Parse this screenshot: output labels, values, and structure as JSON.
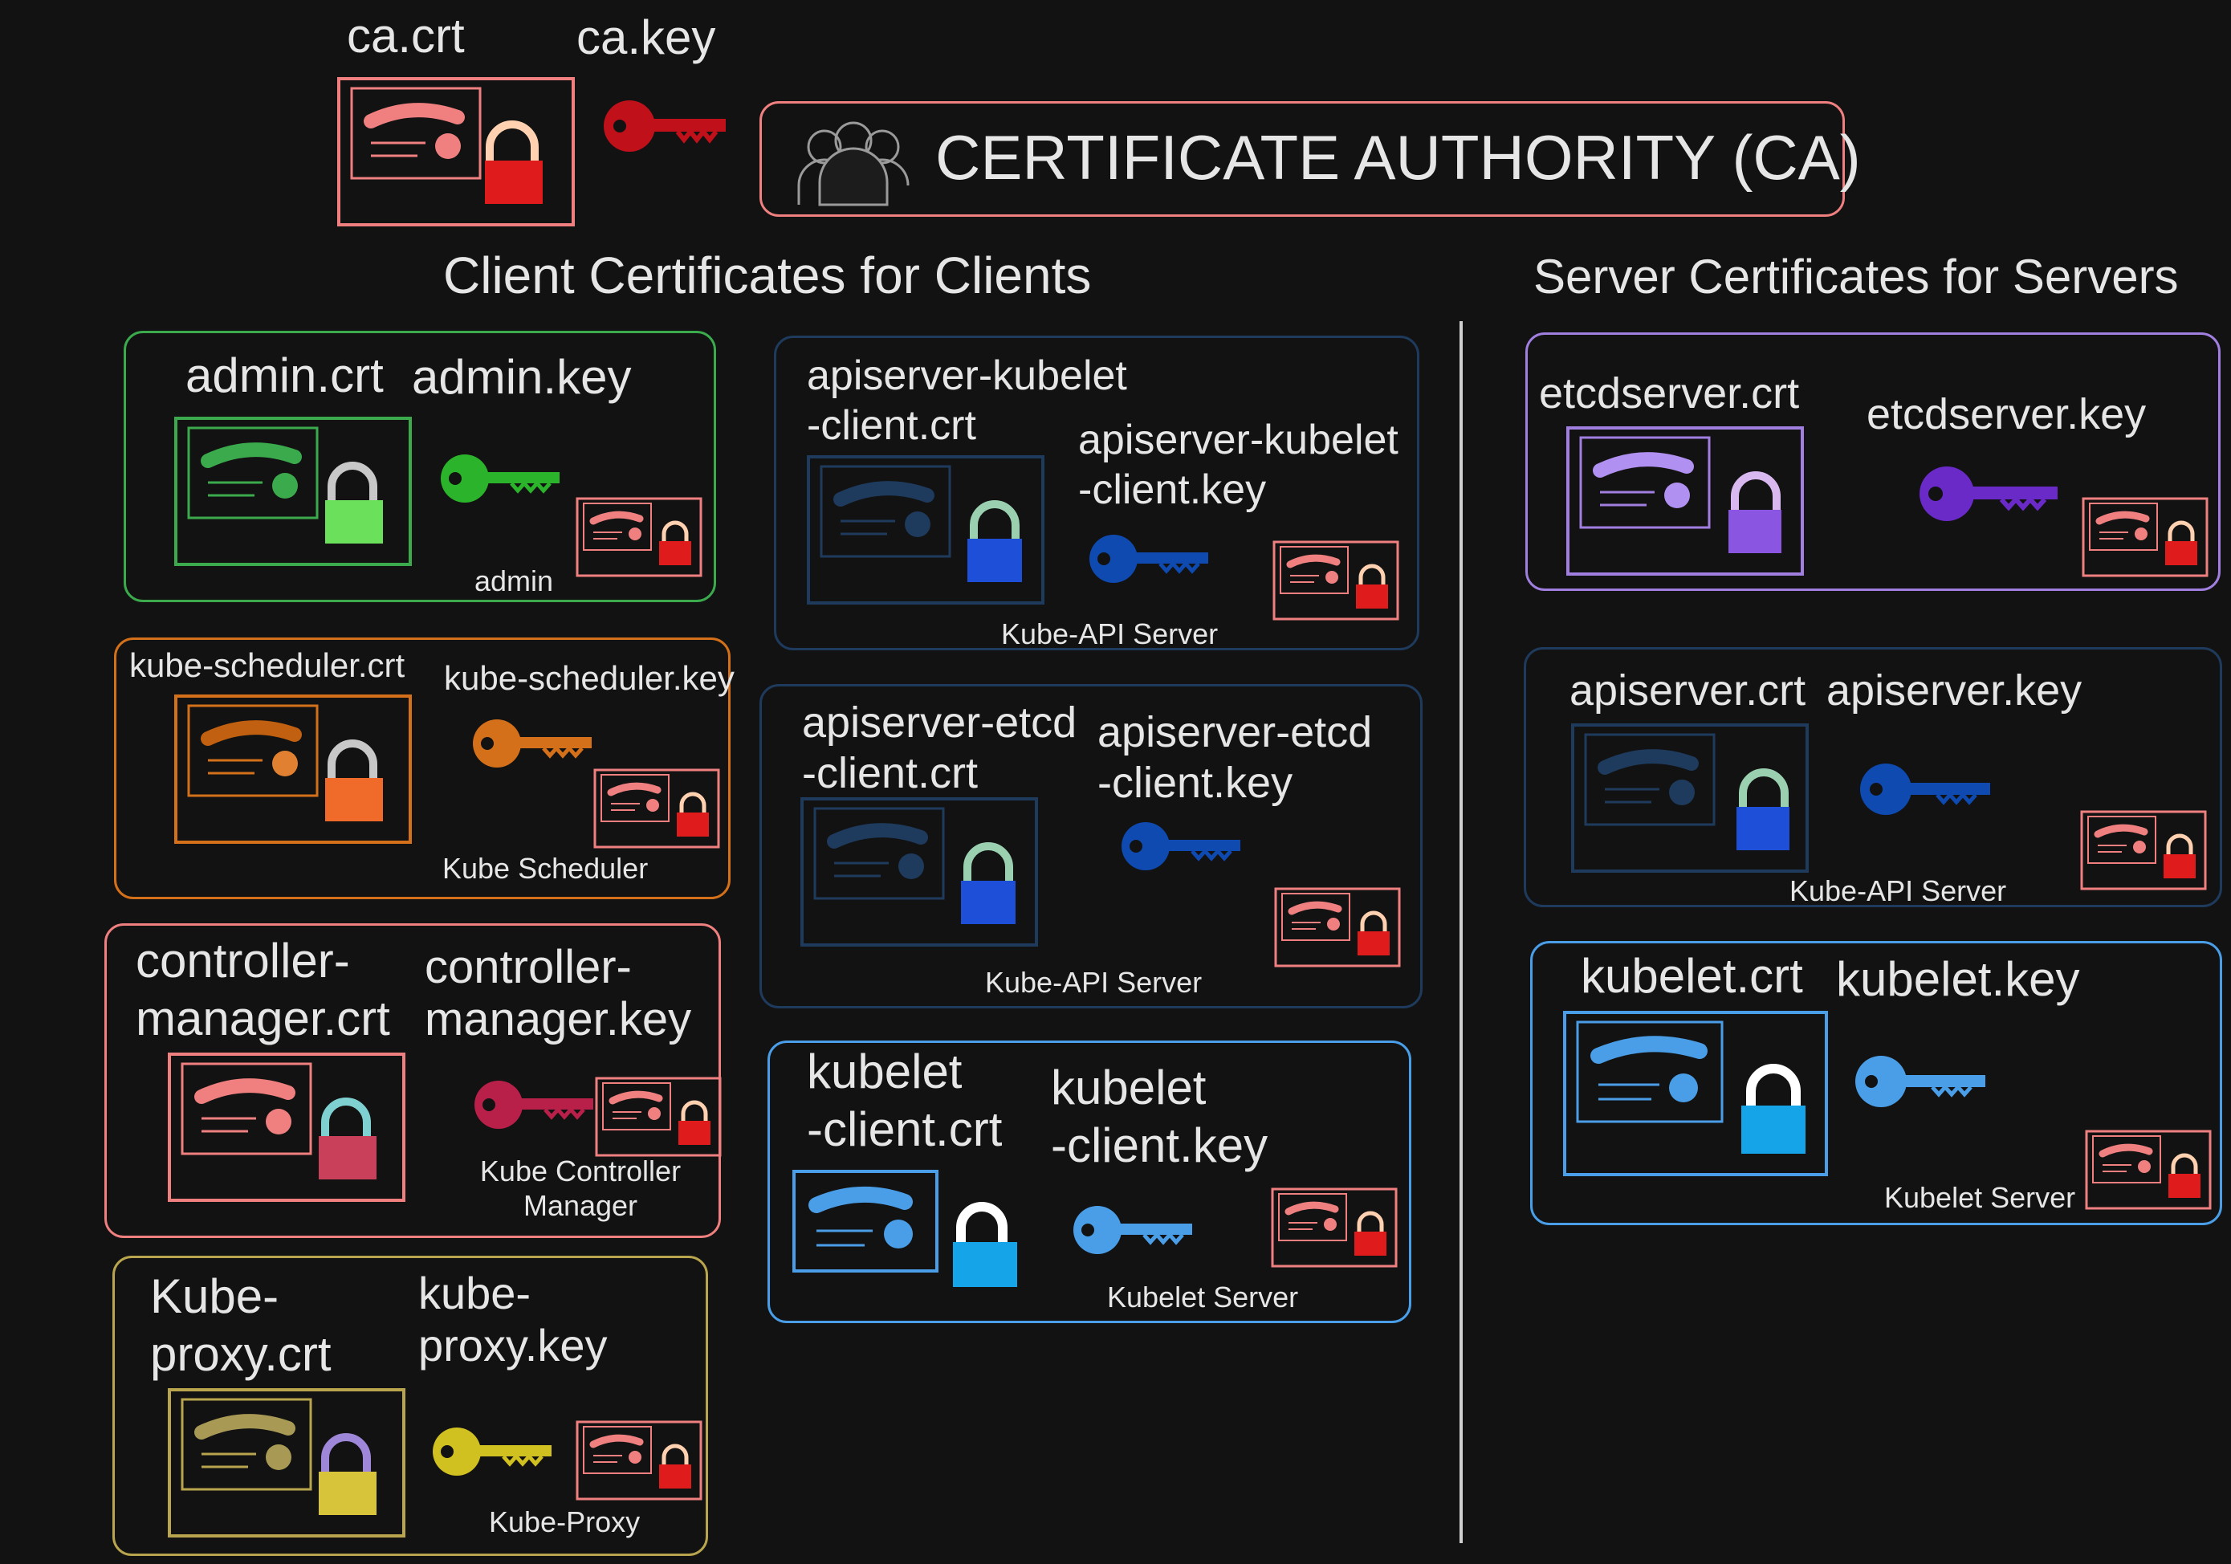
{
  "ca": {
    "crt_label": "ca.crt",
    "key_label": "ca.key",
    "title": "CERTIFICATE AUTHORITY (CA)"
  },
  "headings": {
    "clients": "Client Certificates for Clients",
    "servers": "Server Certificates for Servers"
  },
  "clients": {
    "admin": {
      "crt": "admin.crt",
      "key": "admin.key",
      "owner": "admin",
      "color": "#3aaa4c"
    },
    "scheduler": {
      "crt": "kube-scheduler.crt",
      "key": "kube-scheduler.key",
      "owner": "Kube Scheduler",
      "color": "#d4701a"
    },
    "controller": {
      "crt": "controller-\nmanager.crt",
      "key": "controller-\nmanager.key",
      "owner": "Kube Controller\nManager",
      "color": "#f07f7f"
    },
    "proxy": {
      "crt": "Kube-\nproxy.crt",
      "key": "kube-\nproxy.key",
      "owner": "Kube-Proxy",
      "color": "#b9a54e"
    },
    "apiserver_kubelet": {
      "crt": "apiserver-kubelet\n-client.crt",
      "key": "apiserver-kubelet\n-client.key",
      "owner": "Kube-API Server",
      "color": "#1e3a5c"
    },
    "apiserver_etcd": {
      "crt": "apiserver-etcd\n-client.crt",
      "key": "apiserver-etcd\n-client.key",
      "owner": "Kube-API Server",
      "color": "#1e3a5c"
    },
    "kubelet_client": {
      "crt": "kubelet\n-client.crt",
      "key": "kubelet\n-client.key",
      "owner": "Kubelet Server",
      "color": "#4a9ee8"
    }
  },
  "servers": {
    "etcd": {
      "crt": "etcdserver.crt",
      "key": "etcdserver.key",
      "color": "#a07fe0"
    },
    "apiserver": {
      "crt": "apiserver.crt",
      "key": "apiserver.key",
      "owner": "Kube-API Server",
      "color": "#1e3a5c"
    },
    "kubelet": {
      "crt": "kubelet.crt",
      "key": "kubelet.key",
      "owner": "Kubelet Server",
      "color": "#4a9ee8"
    }
  }
}
